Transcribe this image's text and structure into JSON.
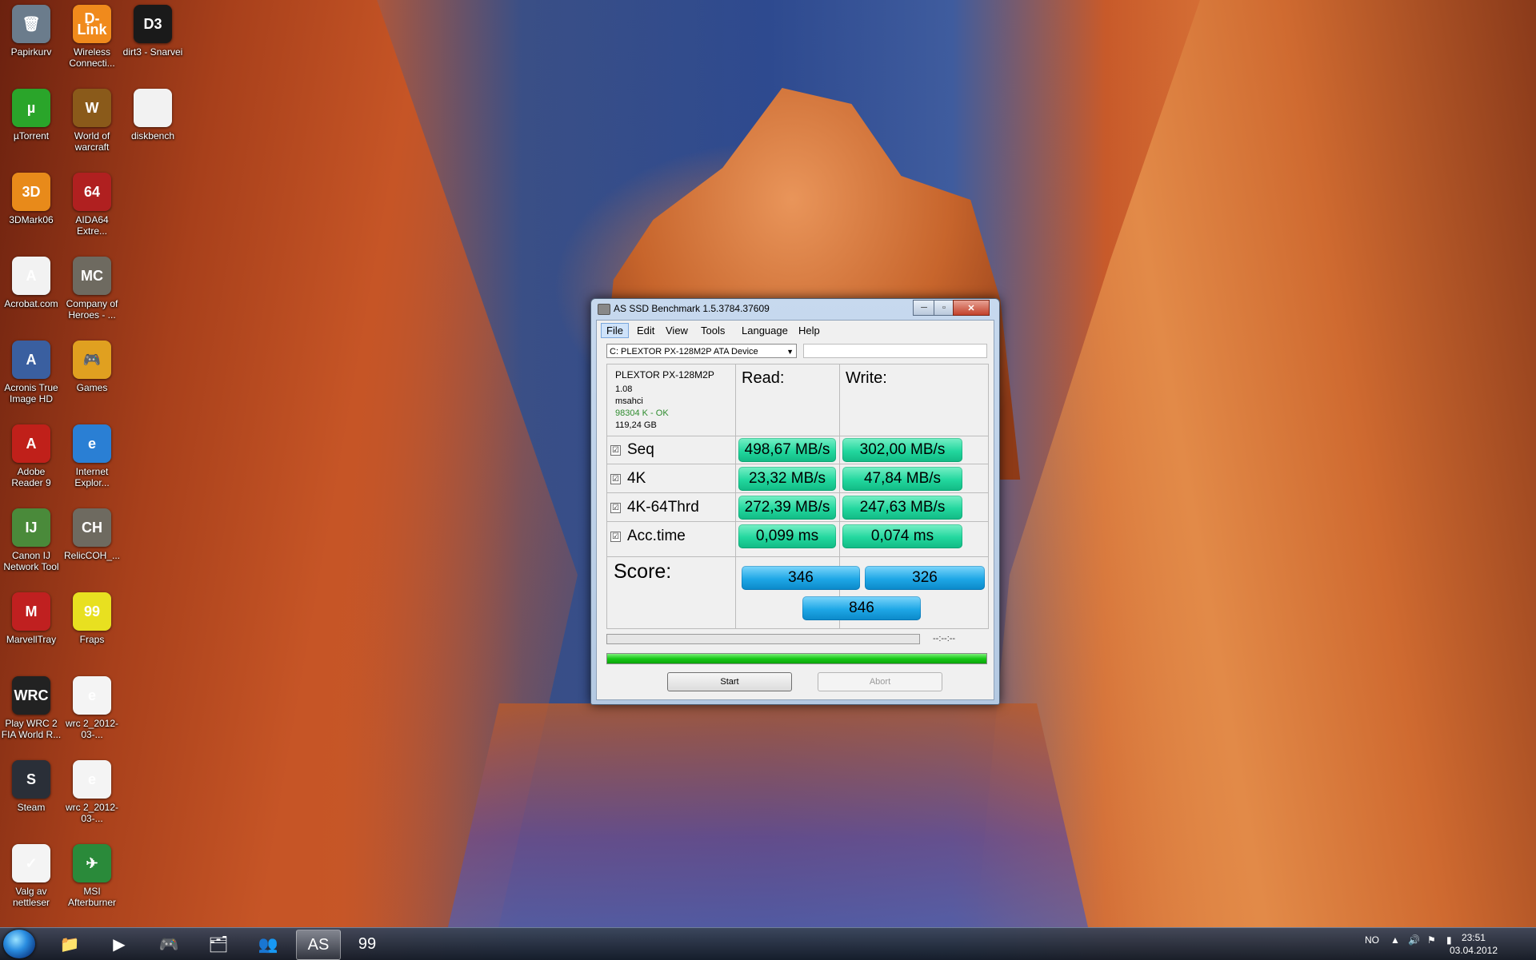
{
  "desktop": {
    "icons": [
      {
        "label": "Papirkurv",
        "color": "#6b7c8c",
        "glyph": "🗑"
      },
      {
        "label": "Wireless Connecti...",
        "color": "#f08a1c",
        "glyph": "D-Link"
      },
      {
        "label": "dirt3 - Snarvei",
        "color": "#1a1a1a",
        "glyph": "D3"
      },
      {
        "label": "µTorrent",
        "color": "#2aa52a",
        "glyph": "µ"
      },
      {
        "label": "World of warcraft",
        "color": "#8a5a1a",
        "glyph": "W"
      },
      {
        "label": "diskbench",
        "color": "#f2f2f2",
        "glyph": ""
      },
      {
        "label": "3DMark06",
        "color": "#e88a1a",
        "glyph": "3D"
      },
      {
        "label": "AIDA64 Extre...",
        "color": "#b02020",
        "glyph": "64"
      },
      {
        "label": "Acrobat.com",
        "color": "#f2f2f2",
        "glyph": "A"
      },
      {
        "label": "Company of Heroes - ...",
        "color": "#6e6a60",
        "glyph": "MC"
      },
      {
        "label": "Acronis True Image HD",
        "color": "#3a5fa0",
        "glyph": "A"
      },
      {
        "label": "Games",
        "color": "#e0a020",
        "glyph": "🎮"
      },
      {
        "label": "Adobe Reader 9",
        "color": "#c0201a",
        "glyph": "A"
      },
      {
        "label": "Internet Explor...",
        "color": "#2a7fd4",
        "glyph": "e"
      },
      {
        "label": "Canon IJ Network Tool",
        "color": "#4a8a3a",
        "glyph": "IJ"
      },
      {
        "label": "RelicCOH_...",
        "color": "#6e6a60",
        "glyph": "CH"
      },
      {
        "label": "MarvellTray",
        "color": "#c02020",
        "glyph": "M"
      },
      {
        "label": "Fraps",
        "color": "#e8e020",
        "glyph": "99"
      },
      {
        "label": "Play WRC 2 FIA World R...",
        "color": "#222222",
        "glyph": "WRC"
      },
      {
        "label": "wrc 2_2012-03-...",
        "color": "#f4f4f4",
        "glyph": "e"
      },
      {
        "label": "Steam",
        "color": "#2a2f38",
        "glyph": "S"
      },
      {
        "label": "wrc 2_2012-03-...",
        "color": "#f4f4f4",
        "glyph": "e"
      },
      {
        "label": "Valg av nettleser",
        "color": "#f4f4f4",
        "glyph": "✓"
      },
      {
        "label": "MSI Afterburner",
        "color": "#2a8a3a",
        "glyph": "✈"
      }
    ]
  },
  "taskbar": {
    "language": "NO",
    "time": "23:51",
    "date": "03.04.2012",
    "buttons": [
      {
        "name": "explorer",
        "glyph": "📁"
      },
      {
        "name": "media-player",
        "glyph": "▶"
      },
      {
        "name": "games",
        "glyph": "🎮"
      },
      {
        "name": "folder",
        "glyph": "🗂"
      },
      {
        "name": "messenger",
        "glyph": "👥"
      },
      {
        "name": "as-ssd",
        "glyph": "AS"
      },
      {
        "name": "fraps",
        "glyph": "99"
      }
    ]
  },
  "window": {
    "title": "AS SSD Benchmark 1.5.3784.37609",
    "menu": [
      "File",
      "Edit",
      "View",
      "Tools",
      "Language",
      "Help"
    ],
    "drive_select": "C: PLEXTOR PX-128M2P ATA Device",
    "drive_info": {
      "model": "PLEXTOR PX-128M2P",
      "firmware": "1.08",
      "driver": "msahci",
      "alignment": "98304 K - OK",
      "size": "119,24 GB"
    },
    "headers": {
      "read": "Read:",
      "write": "Write:"
    },
    "rows": [
      {
        "label": "Seq",
        "checked": "☑",
        "read": "498,67 MB/s",
        "write": "302,00 MB/s"
      },
      {
        "label": "4K",
        "checked": "☑",
        "read": "23,32 MB/s",
        "write": "47,84 MB/s"
      },
      {
        "label": "4K-64Thrd",
        "checked": "☑",
        "read": "272,39 MB/s",
        "write": "247,63 MB/s"
      },
      {
        "label": "Acc.time",
        "checked": "☑",
        "read": "0,099 ms",
        "write": "0,074 ms"
      }
    ],
    "score": {
      "label": "Score:",
      "read": "346",
      "write": "326",
      "total": "846"
    },
    "eta": "--:--:--",
    "progress_percent": 100,
    "buttons": {
      "start": "Start",
      "abort": "Abort"
    }
  }
}
